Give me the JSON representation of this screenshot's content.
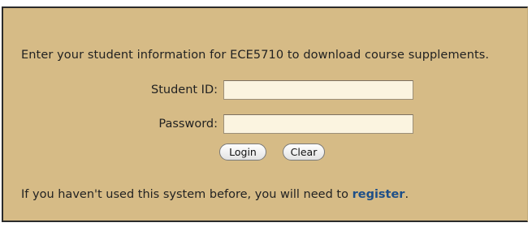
{
  "login_form": {
    "intro_text": "Enter your student information for ECE5710 to download course supplements.",
    "student_id": {
      "label": "Student ID:",
      "value": ""
    },
    "password": {
      "label": "Password:",
      "value": ""
    },
    "buttons": {
      "login_label": "Login",
      "clear_label": "Clear"
    },
    "footer": {
      "prefix": "If you haven't used this system before, you will need to ",
      "link_text": "register",
      "suffix": "."
    }
  },
  "colors": {
    "panel_background": "#d6bb86",
    "link": "#1e4f88",
    "input_background": "#fbf4e0"
  }
}
